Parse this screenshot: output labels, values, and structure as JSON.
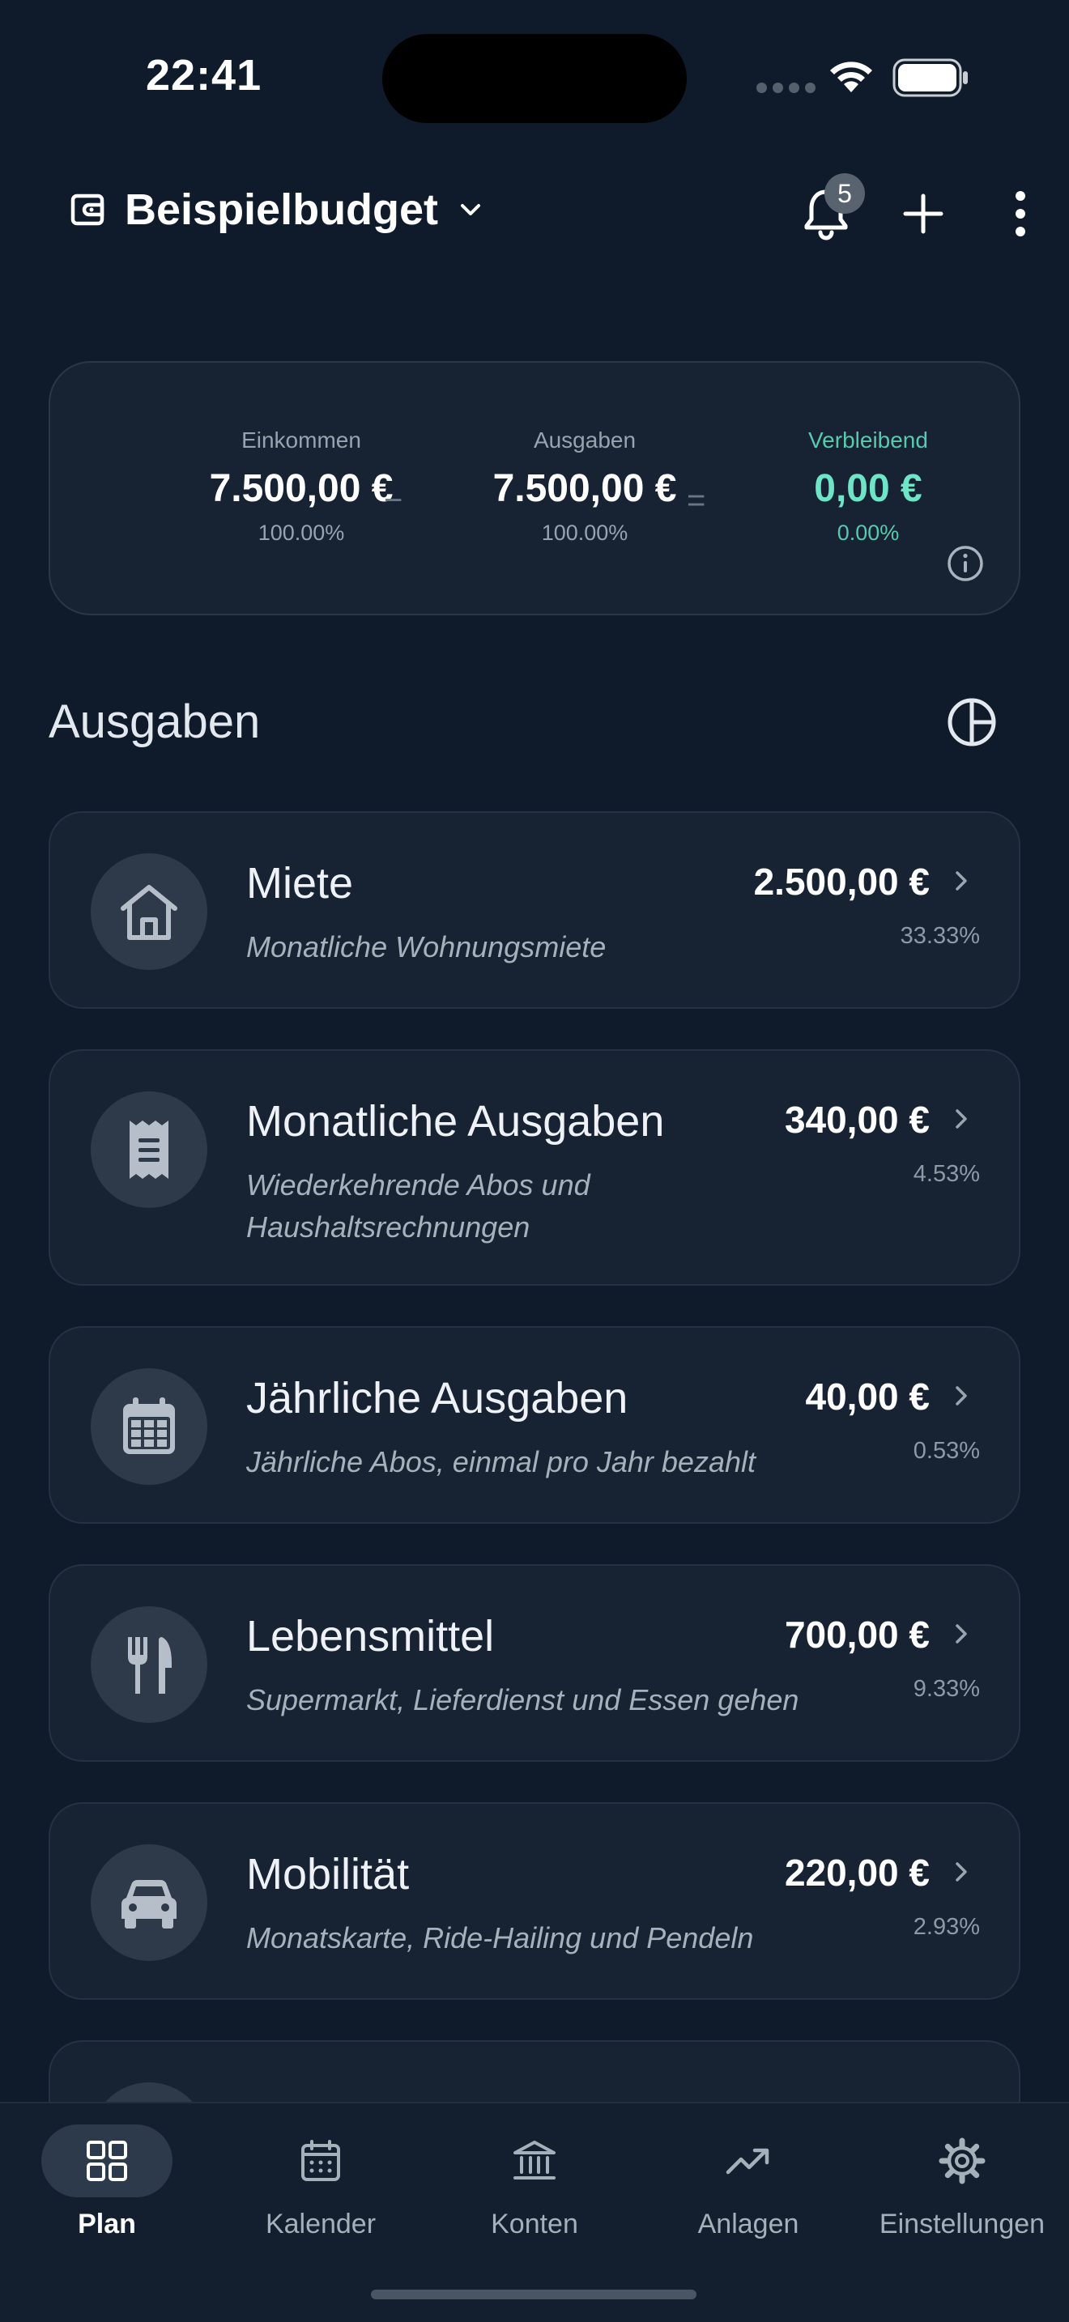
{
  "status_bar": {
    "time": "22:41"
  },
  "header": {
    "budget_name": "Beispielbudget",
    "notification_count": "5"
  },
  "summary": {
    "income": {
      "label": "Einkommen",
      "value": "7.500,00 €",
      "percent": "100.00%"
    },
    "minus": "−",
    "expenses": {
      "label": "Ausgaben",
      "value": "7.500,00 €",
      "percent": "100.00%"
    },
    "equals": "=",
    "remaining": {
      "label": "Verbleibend",
      "value": "0,00 €",
      "percent": "0.00%"
    }
  },
  "section": {
    "title": "Ausgaben"
  },
  "categories": [
    {
      "icon": "home-icon",
      "title": "Miete",
      "description": "Monatliche Wohnungsmiete",
      "amount": "2.500,00 €",
      "percent": "33.33%"
    },
    {
      "icon": "receipt-icon",
      "title": "Monatliche Ausgaben",
      "description": "Wiederkehrende Abos und Haushaltsrechnungen",
      "amount": "340,00 €",
      "percent": "4.53%"
    },
    {
      "icon": "calendar-icon",
      "title": "Jährliche Ausgaben",
      "description": "Jährliche Abos, einmal pro Jahr bezahlt",
      "amount": "40,00 €",
      "percent": "0.53%"
    },
    {
      "icon": "restaurant-icon",
      "title": "Lebensmittel",
      "description": "Supermarkt, Lieferdienst und Essen gehen",
      "amount": "700,00 €",
      "percent": "9.33%"
    },
    {
      "icon": "car-icon",
      "title": "Mobilität",
      "description": "Monatskarte, Ride-Hailing und Pendeln",
      "amount": "220,00 €",
      "percent": "2.93%"
    }
  ],
  "nav": [
    {
      "label": "Plan",
      "icon": "grid-icon",
      "active": true
    },
    {
      "label": "Kalender",
      "icon": "calendar-icon",
      "active": false
    },
    {
      "label": "Konten",
      "icon": "bank-icon",
      "active": false
    },
    {
      "label": "Anlagen",
      "icon": "trending-up-icon",
      "active": false
    },
    {
      "label": "Einstellungen",
      "icon": "gear-icon",
      "active": false
    }
  ],
  "colors": {
    "background": "#0f1b2b",
    "card": "#172333",
    "accent_remaining": "#6ee5c7"
  }
}
